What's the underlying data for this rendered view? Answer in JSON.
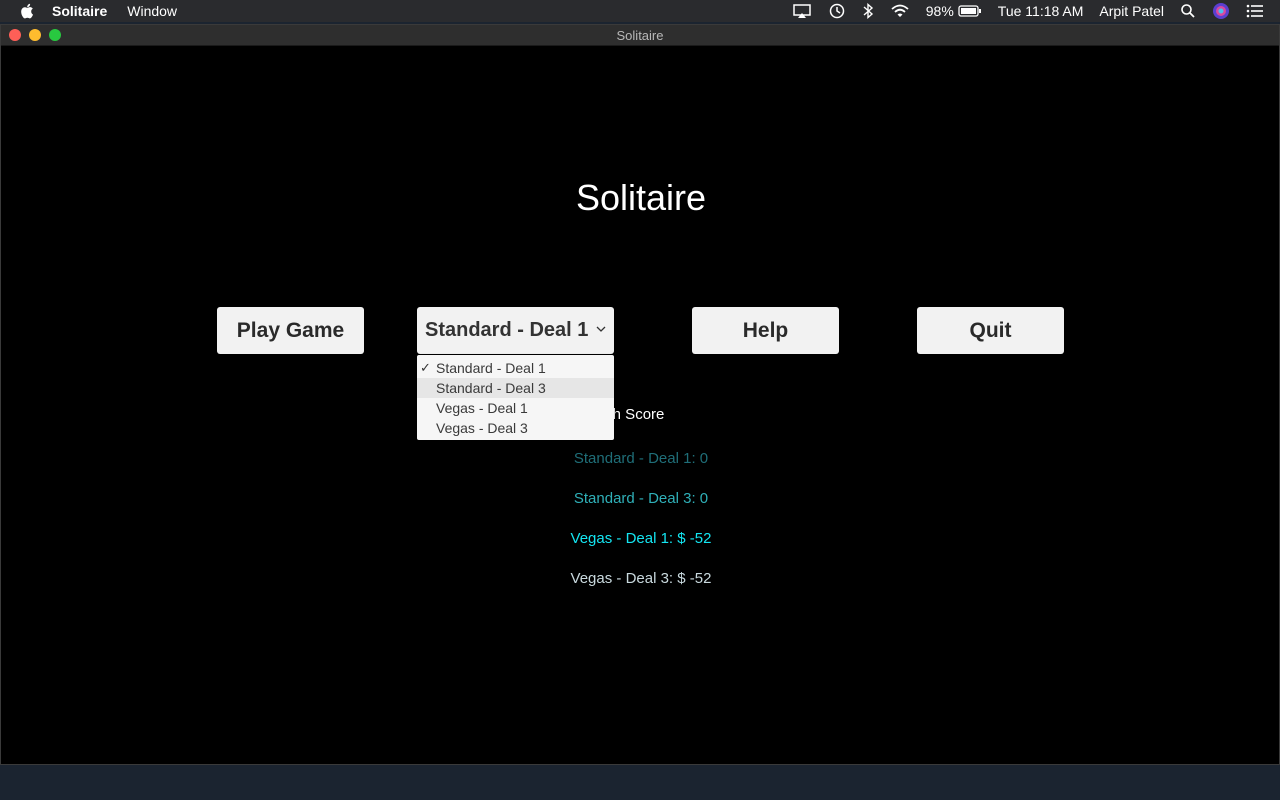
{
  "menubar": {
    "app_name": "Solitaire",
    "menus": [
      "Window"
    ],
    "battery": "98%",
    "clock": "Tue 11:18 AM",
    "user": "Arpit Patel",
    "icons": [
      "apple-icon",
      "airplay-icon",
      "time-machine-icon",
      "bluetooth-icon",
      "wifi-icon",
      "battery-icon",
      "spotlight-search-icon",
      "siri-icon",
      "notification-center-icon"
    ]
  },
  "window": {
    "title": "Solitaire"
  },
  "game": {
    "title": "Solitaire",
    "play_label": "Play Game",
    "help_label": "Help",
    "quit_label": "Quit",
    "mode_select": {
      "selected": "Standard - Deal 1",
      "options": [
        "Standard - Deal 1",
        "Standard - Deal 3",
        "Vegas - Deal 1",
        "Vegas - Deal 3"
      ],
      "checked_index": 0,
      "highlighted_index": 1
    },
    "high_score_label": "igh Score",
    "scores": [
      "Standard - Deal 1: 0",
      "Standard - Deal 3: 0",
      "Vegas - Deal 1: $ -52",
      "Vegas - Deal 3: $ -52"
    ],
    "score_colors": [
      "#1f6e78",
      "#2fb0b8",
      "#14e6f2",
      "#c9d9de"
    ]
  }
}
